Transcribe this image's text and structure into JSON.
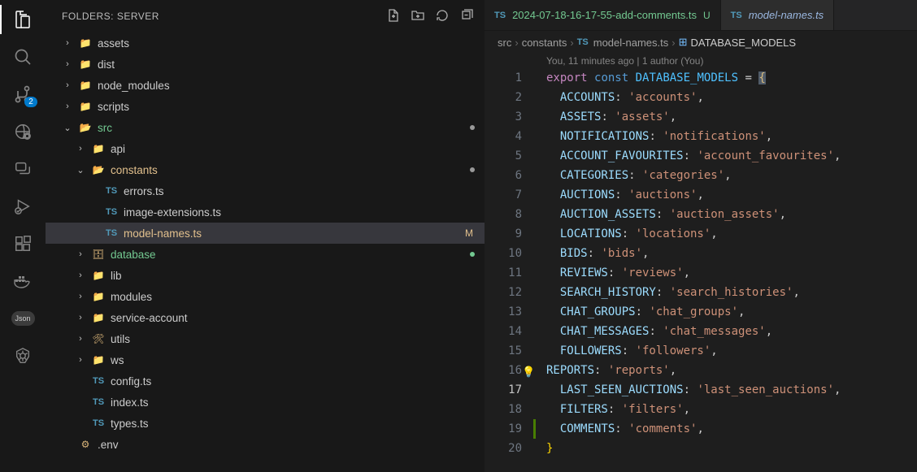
{
  "sidebar": {
    "title": "FOLDERS: SERVER",
    "badge_scm": "2",
    "json_label": "Json"
  },
  "tree": [
    {
      "indent": 1,
      "type": "folder",
      "chev": ">",
      "icon": "📁",
      "label": "assets",
      "cls": ""
    },
    {
      "indent": 1,
      "type": "folder",
      "chev": ">",
      "icon": "📁",
      "label": "dist",
      "cls": ""
    },
    {
      "indent": 1,
      "type": "folder",
      "chev": ">",
      "icon": "📁",
      "label": "node_modules",
      "cls": ""
    },
    {
      "indent": 1,
      "type": "folder",
      "chev": ">",
      "icon": "📁",
      "label": "scripts",
      "cls": ""
    },
    {
      "indent": 1,
      "type": "folder",
      "chev": "v",
      "icon": "📂",
      "label": "src",
      "cls": "green",
      "dot": true,
      "fg": "folder-icon green"
    },
    {
      "indent": 2,
      "type": "folder",
      "chev": ">",
      "icon": "📁",
      "label": "api",
      "cls": ""
    },
    {
      "indent": 2,
      "type": "folder",
      "chev": "v",
      "icon": "📂",
      "label": "constants",
      "cls": "yellow",
      "dot": true
    },
    {
      "indent": 3,
      "type": "file",
      "icon": "TS",
      "label": "errors.ts"
    },
    {
      "indent": 3,
      "type": "file",
      "icon": "TS",
      "label": "image-extensions.ts"
    },
    {
      "indent": 3,
      "type": "file",
      "icon": "TS",
      "label": "model-names.ts",
      "cls": "yellow",
      "selected": true,
      "mod": "M"
    },
    {
      "indent": 2,
      "type": "folder",
      "chev": ">",
      "icon": "🗄",
      "label": "database",
      "cls": "green",
      "dot": true,
      "dotcolor": "#73c991"
    },
    {
      "indent": 2,
      "type": "folder",
      "chev": ">",
      "icon": "📁",
      "label": "lib",
      "cls": ""
    },
    {
      "indent": 2,
      "type": "folder",
      "chev": ">",
      "icon": "📁",
      "label": "modules",
      "cls": ""
    },
    {
      "indent": 2,
      "type": "folder",
      "chev": ">",
      "icon": "📁",
      "label": "service-account",
      "cls": ""
    },
    {
      "indent": 2,
      "type": "folder",
      "chev": ">",
      "icon": "🛠",
      "label": "utils",
      "cls": ""
    },
    {
      "indent": 2,
      "type": "folder",
      "chev": ">",
      "icon": "📁",
      "label": "ws",
      "cls": ""
    },
    {
      "indent": 2,
      "type": "file",
      "icon": "TS",
      "label": "config.ts"
    },
    {
      "indent": 2,
      "type": "file",
      "icon": "TS",
      "label": "index.ts"
    },
    {
      "indent": 2,
      "type": "file",
      "icon": "TS",
      "label": "types.ts"
    },
    {
      "indent": 1,
      "type": "file",
      "icon": "⚙",
      "label": ".env"
    }
  ],
  "tabs": [
    {
      "icon": "TS",
      "name": "2024-07-18-16-17-55-add-comments.ts",
      "status": "U",
      "active": true,
      "fn_cls": "fn"
    },
    {
      "icon": "TS",
      "name": "model-names.ts",
      "status": "",
      "active": false,
      "fn_cls": "fn italic"
    }
  ],
  "breadcrumb": {
    "parts": [
      "src",
      "constants",
      "model-names.ts",
      "DATABASE_MODELS"
    ],
    "ts_icon": "TS",
    "sym_icon": "📇"
  },
  "codelens": "You, 11 minutes ago | 1 author (You)",
  "code": {
    "lines": [
      {
        "n": 1,
        "tokens": [
          [
            "kw",
            "export"
          ],
          [
            "sp",
            " "
          ],
          [
            "kw2",
            "const"
          ],
          [
            "sp",
            " "
          ],
          [
            "ident",
            "DATABASE_MODELS"
          ],
          [
            "sp",
            " "
          ],
          [
            "punct",
            "= "
          ],
          [
            "brh",
            "{"
          ]
        ]
      },
      {
        "n": 2,
        "tokens": [
          [
            "ind",
            "  "
          ],
          [
            "prop",
            "ACCOUNTS"
          ],
          [
            "punct",
            ": "
          ],
          [
            "str",
            "'accounts'"
          ],
          [
            "punct",
            ","
          ]
        ]
      },
      {
        "n": 3,
        "tokens": [
          [
            "ind",
            "  "
          ],
          [
            "prop",
            "ASSETS"
          ],
          [
            "punct",
            ": "
          ],
          [
            "str",
            "'assets'"
          ],
          [
            "punct",
            ","
          ]
        ]
      },
      {
        "n": 4,
        "tokens": [
          [
            "ind",
            "  "
          ],
          [
            "prop",
            "NOTIFICATIONS"
          ],
          [
            "punct",
            ": "
          ],
          [
            "str",
            "'notifications'"
          ],
          [
            "punct",
            ","
          ]
        ]
      },
      {
        "n": 5,
        "tokens": [
          [
            "ind",
            "  "
          ],
          [
            "prop",
            "ACCOUNT_FAVOURITES"
          ],
          [
            "punct",
            ": "
          ],
          [
            "str",
            "'account_favourites'"
          ],
          [
            "punct",
            ","
          ]
        ]
      },
      {
        "n": 6,
        "tokens": [
          [
            "ind",
            "  "
          ],
          [
            "prop",
            "CATEGORIES"
          ],
          [
            "punct",
            ": "
          ],
          [
            "str",
            "'categories'"
          ],
          [
            "punct",
            ","
          ]
        ]
      },
      {
        "n": 7,
        "tokens": [
          [
            "ind",
            "  "
          ],
          [
            "prop",
            "AUCTIONS"
          ],
          [
            "punct",
            ": "
          ],
          [
            "str",
            "'auctions'"
          ],
          [
            "punct",
            ","
          ]
        ]
      },
      {
        "n": 8,
        "tokens": [
          [
            "ind",
            "  "
          ],
          [
            "prop",
            "AUCTION_ASSETS"
          ],
          [
            "punct",
            ": "
          ],
          [
            "str",
            "'auction_assets'"
          ],
          [
            "punct",
            ","
          ]
        ]
      },
      {
        "n": 9,
        "tokens": [
          [
            "ind",
            "  "
          ],
          [
            "prop",
            "LOCATIONS"
          ],
          [
            "punct",
            ": "
          ],
          [
            "str",
            "'locations'"
          ],
          [
            "punct",
            ","
          ]
        ]
      },
      {
        "n": 10,
        "tokens": [
          [
            "ind",
            "  "
          ],
          [
            "prop",
            "BIDS"
          ],
          [
            "punct",
            ": "
          ],
          [
            "str",
            "'bids'"
          ],
          [
            "punct",
            ","
          ]
        ]
      },
      {
        "n": 11,
        "tokens": [
          [
            "ind",
            "  "
          ],
          [
            "prop",
            "REVIEWS"
          ],
          [
            "punct",
            ": "
          ],
          [
            "str",
            "'reviews'"
          ],
          [
            "punct",
            ","
          ]
        ]
      },
      {
        "n": 12,
        "tokens": [
          [
            "ind",
            "  "
          ],
          [
            "prop",
            "SEARCH_HISTORY"
          ],
          [
            "punct",
            ": "
          ],
          [
            "str",
            "'search_histories'"
          ],
          [
            "punct",
            ","
          ]
        ]
      },
      {
        "n": 13,
        "tokens": [
          [
            "ind",
            "  "
          ],
          [
            "prop",
            "CHAT_GROUPS"
          ],
          [
            "punct",
            ": "
          ],
          [
            "str",
            "'chat_groups'"
          ],
          [
            "punct",
            ","
          ]
        ]
      },
      {
        "n": 14,
        "tokens": [
          [
            "ind",
            "  "
          ],
          [
            "prop",
            "CHAT_MESSAGES"
          ],
          [
            "punct",
            ": "
          ],
          [
            "str",
            "'chat_messages'"
          ],
          [
            "punct",
            ","
          ]
        ]
      },
      {
        "n": 15,
        "tokens": [
          [
            "ind",
            "  "
          ],
          [
            "prop",
            "FOLLOWERS"
          ],
          [
            "punct",
            ": "
          ],
          [
            "str",
            "'followers'"
          ],
          [
            "punct",
            ","
          ]
        ]
      },
      {
        "n": 16,
        "tokens": [
          [
            "ind0",
            ""
          ],
          [
            "prop",
            "REPORTS"
          ],
          [
            "punct",
            ": "
          ],
          [
            "str",
            "'reports'"
          ],
          [
            "punct",
            ","
          ]
        ],
        "bulb": true
      },
      {
        "n": 17,
        "tokens": [
          [
            "ind",
            "  "
          ],
          [
            "prop",
            "LAST_SEEN_AUCTIONS"
          ],
          [
            "punct",
            ": "
          ],
          [
            "str",
            "'last_seen_auctions'"
          ],
          [
            "punct",
            ","
          ]
        ],
        "cur": true
      },
      {
        "n": 18,
        "tokens": [
          [
            "ind",
            "  "
          ],
          [
            "prop",
            "FILTERS"
          ],
          [
            "punct",
            ": "
          ],
          [
            "str",
            "'filters'"
          ],
          [
            "punct",
            ","
          ]
        ]
      },
      {
        "n": 19,
        "tokens": [
          [
            "ind",
            "  "
          ],
          [
            "prop",
            "COMMENTS"
          ],
          [
            "punct",
            ": "
          ],
          [
            "str",
            "'comments'"
          ],
          [
            "punct",
            ","
          ]
        ],
        "greenbar": true
      },
      {
        "n": 20,
        "tokens": [
          [
            "bry",
            "}"
          ]
        ]
      }
    ]
  }
}
